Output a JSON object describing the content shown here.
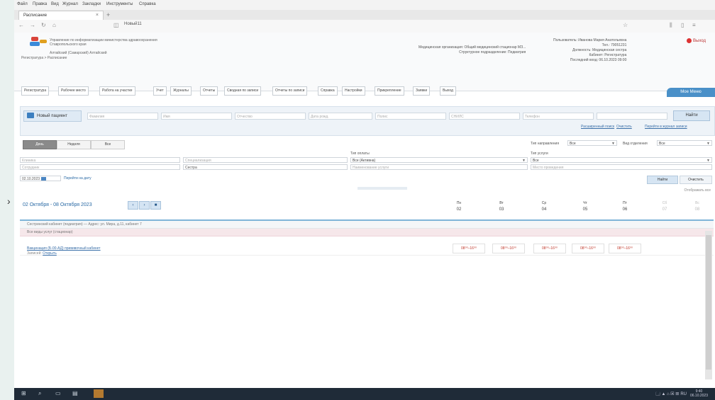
{
  "browser": {
    "menu": [
      "Файл",
      "Правка",
      "Вид",
      "Журнал",
      "Закладки",
      "Инструменты",
      "Справка"
    ],
    "tab_title": "Расписание",
    "tab_close": "×",
    "new_tab": "+",
    "url": "Новый11",
    "controls": {
      "minimize": "–",
      "maximize": "▢",
      "close": "×"
    }
  },
  "header": {
    "org_line1": "Управление по информатизации министерства здравоохранения",
    "org_line2": "Ставропольского края",
    "region": "Алтайский (Самарский) Алтайский",
    "breadcrumb": "Регистратура > Расписание",
    "mid_line1": "Медицинская организация: Общий медицинский стационар МЗ...",
    "mid_line2": "Структурное подразделение: Педиатрия",
    "right_line1": "Пользователь: Иванова Мария Анатольевна",
    "right_line2": "Тел.: 79051231",
    "right_line3": "Должность: Медицинская сестра",
    "right_line4": "Кабинет: Регистратура",
    "right_line5": "Последний вход: 06.10.2023 09:00",
    "exit": "Выход",
    "ribbon": "Мое Меню"
  },
  "nav": [
    "Регистратура",
    "Рабочее место",
    "Работа на участке",
    "Учет",
    "Журналы",
    "Отчеты",
    "Сводная по записи",
    "Отчеты по записи",
    "Справка",
    "Настройки",
    "Прикрепление",
    "Заявки",
    "Выход"
  ],
  "filter": {
    "patient_button": "Новый пациент",
    "fields": [
      "Фамилия",
      "Имя",
      "Отчество",
      "Дата рожд.",
      "Полис",
      "СНИЛС",
      "Телефон"
    ],
    "find_button": "Найти",
    "links": [
      "Расширенный поиск",
      "Очистить",
      "Перейти в журнал записи"
    ]
  },
  "schedule": {
    "segments": [
      "День",
      "Неделя",
      "Все"
    ],
    "referral_label": "Тип направления",
    "referral_value": "Все",
    "dept_label": "Вид отделения",
    "dept_value": "Все",
    "payment_label": "Тип оплаты",
    "service_label": "Тип услуги",
    "field_left": "Клиника",
    "field_mid": "Специализация",
    "field_status": "Все (Активна)",
    "field_right": "Все",
    "field_staff": "Сотрудник",
    "field_doctor": "Лечащий врач",
    "field_room": "Кабинет",
    "field_room_value": "Сестра",
    "field_visit": "Наименование услуги",
    "field_place": "Место проведения",
    "date_value": "02.10.2023",
    "go_to_day": "Перейти на дату",
    "apply_button": "Найти",
    "clear_button": "Очистить",
    "display_all": "Отображать все"
  },
  "week": {
    "range": "02 Октября - 08 Октября 2023",
    "prev": "‹",
    "next": "›",
    "today": "■",
    "days": [
      {
        "name": "Пн",
        "date": "02"
      },
      {
        "name": "Вт",
        "date": "03"
      },
      {
        "name": "Ср",
        "date": "04"
      },
      {
        "name": "Чт",
        "date": "05"
      },
      {
        "name": "Пт",
        "date": "06"
      },
      {
        "name": "Сб",
        "date": "07"
      },
      {
        "name": "Вс",
        "date": "08"
      }
    ]
  },
  "rows": {
    "group": "Сестринский кабинет (педиатрия) — Адрес: ул. Мира, д.11, кабинет 7",
    "subgroup": "Все виды услуг (стационар)",
    "service_name": "Вакцинация (Б-00-АД) прививочный кабинет",
    "service_sub_prefix": "Записей:",
    "service_sub_link": "Открыть",
    "slots": [
      "08⁰⁰–16⁰⁰",
      "08⁰⁰–16⁰⁰",
      "08⁰⁰–16⁰⁰",
      "08⁰⁰–16⁰⁰",
      "08⁰⁰–16⁰⁰"
    ]
  },
  "taskbar": {
    "start": "⊞",
    "search": "⌕",
    "taskview": "▭",
    "tray": "🗔 ▲ ⌂ ▣ ☰ RU",
    "time": "9:40",
    "date": "06.10.2023"
  }
}
